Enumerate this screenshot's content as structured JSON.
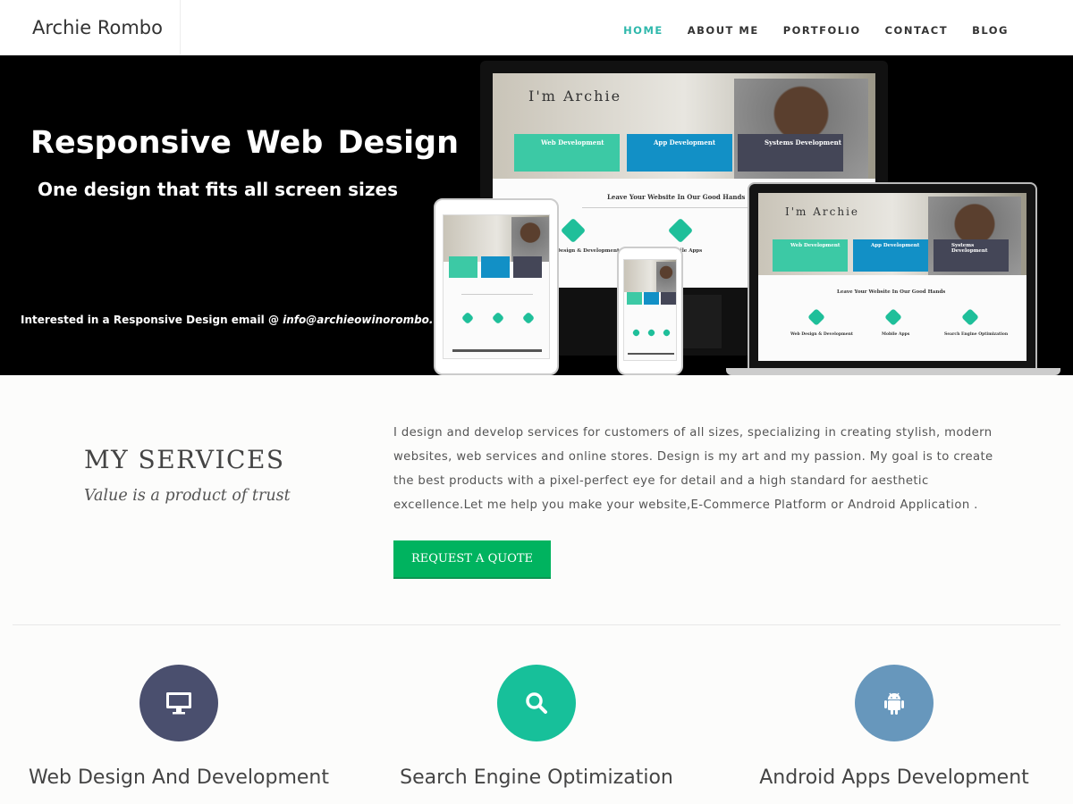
{
  "header": {
    "brand": "Archie Rombo",
    "nav": [
      "HOME",
      "ABOUT ME",
      "PORTFOLIO",
      "CONTACT",
      "BLOG"
    ],
    "active": "HOME"
  },
  "hero": {
    "title": "Responsive  Web Design",
    "subtitle": "One design that fits all screen sizes",
    "email_prefix": "Interested  in a Responsive Design email @ ",
    "email": "info@archieowinorombo.com",
    "mockup": {
      "headline": "I'm Archie",
      "tiles": [
        "Web Development",
        "App Development",
        "Systems Development"
      ],
      "section_heading": "Leave Your Website In Our Good Hands",
      "features": [
        "Web Design & Development",
        "Mobile Apps",
        "Search Engine Optimization"
      ]
    }
  },
  "services": {
    "title": "MY SERVICES",
    "subtitle": "Value is a product of trust",
    "description": "I design and develop services for customers of all sizes, specializing in creating stylish, modern websites, web services and online stores. Design is my art and my passion. My goal is to create the best products with a pixel-perfect eye for detail and a high standard for aesthetic excellence.Let me help you make your website,E-Commerce Platform or Android Application .",
    "button": "REQUEST A QUOTE"
  },
  "features": [
    {
      "title": "Web Design And Development",
      "icon": "monitor-icon",
      "color": "#4a4f6e"
    },
    {
      "title": "Search Engine Optimization",
      "icon": "search-icon",
      "color": "#17c09a"
    },
    {
      "title": "Android Apps Development",
      "icon": "android-icon",
      "color": "#6797bc"
    }
  ],
  "colors": {
    "accent": "#2fb8ac",
    "button": "#00b35f"
  }
}
